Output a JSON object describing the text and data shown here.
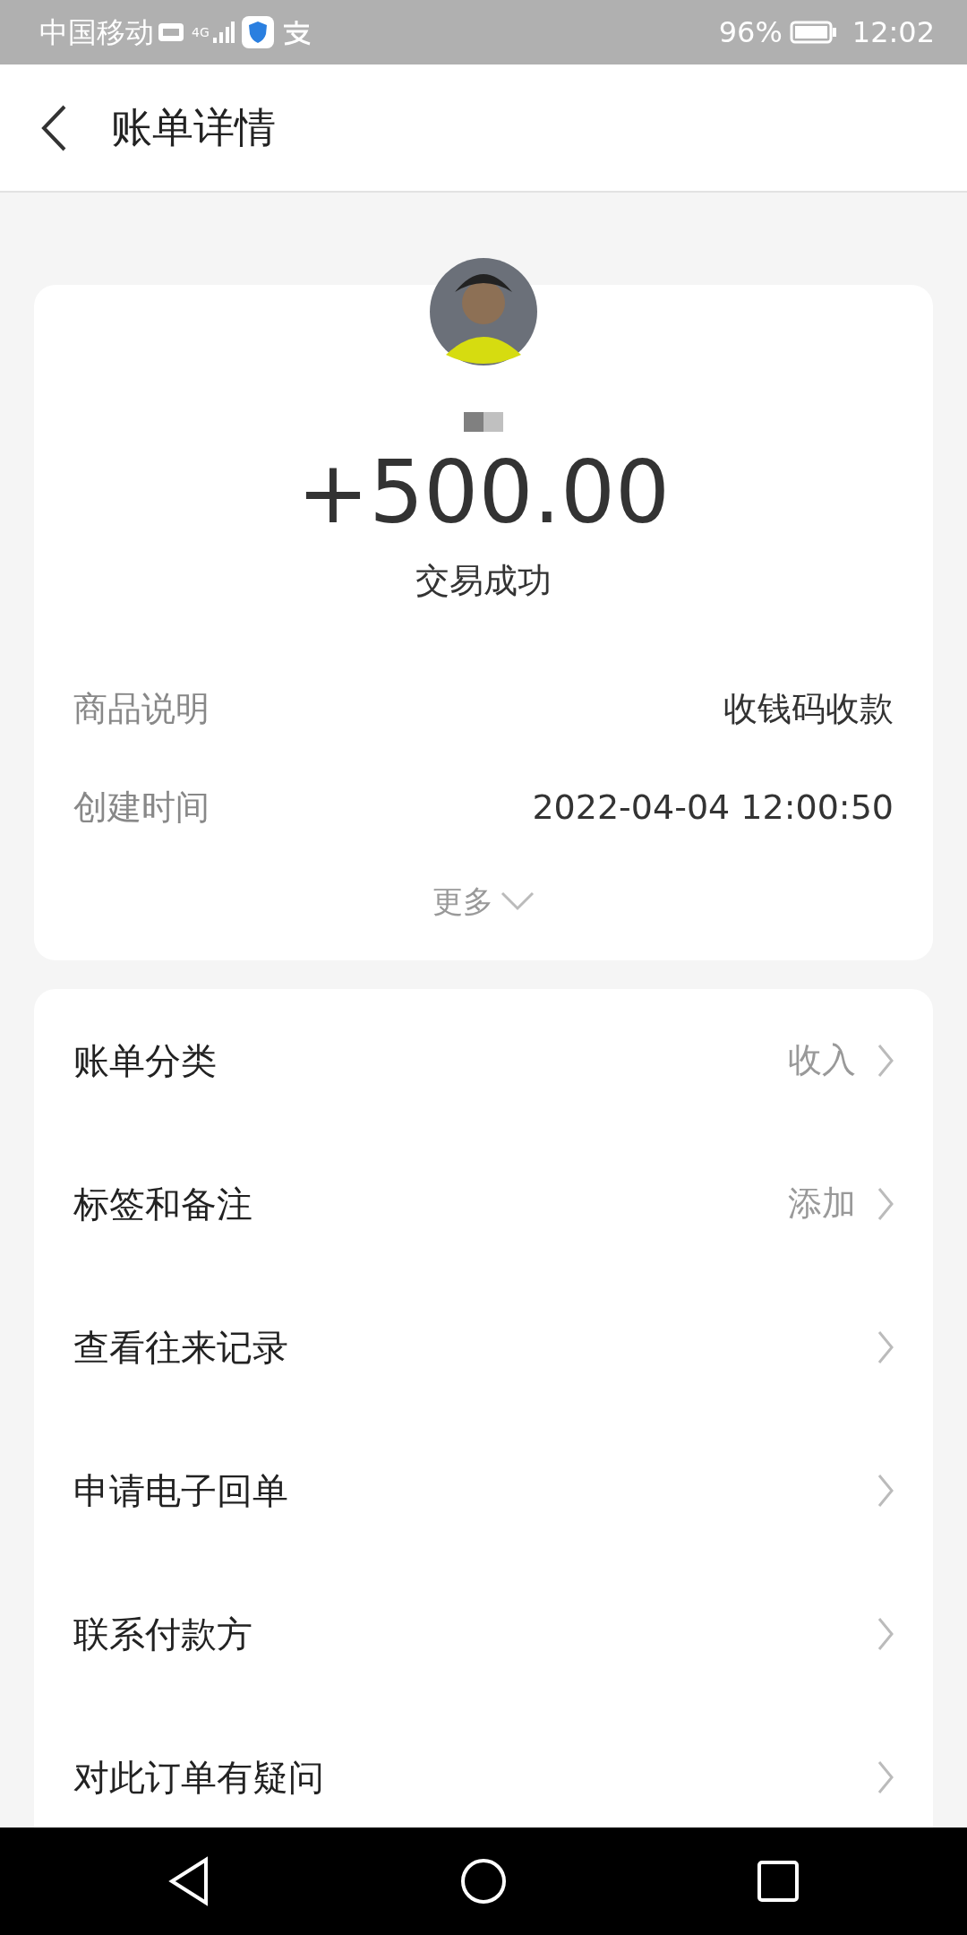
{
  "status_bar": {
    "carrier": "中国移动",
    "network": "4G",
    "battery": "96%",
    "time": "12:02"
  },
  "header": {
    "title": "账单详情"
  },
  "summary": {
    "amount": "+500.00",
    "status": "交易成功",
    "details": [
      {
        "label": "商品说明",
        "value": "收钱码收款"
      },
      {
        "label": "创建时间",
        "value": "2022-04-04 12:00:50"
      }
    ],
    "more": "更多"
  },
  "actions": [
    {
      "label": "账单分类",
      "value": "收入"
    },
    {
      "label": "标签和备注",
      "value": "添加"
    },
    {
      "label": "查看往来记录"
    },
    {
      "label": "申请电子回单"
    },
    {
      "label": "联系付款方"
    },
    {
      "label": "对此订单有疑问"
    }
  ]
}
